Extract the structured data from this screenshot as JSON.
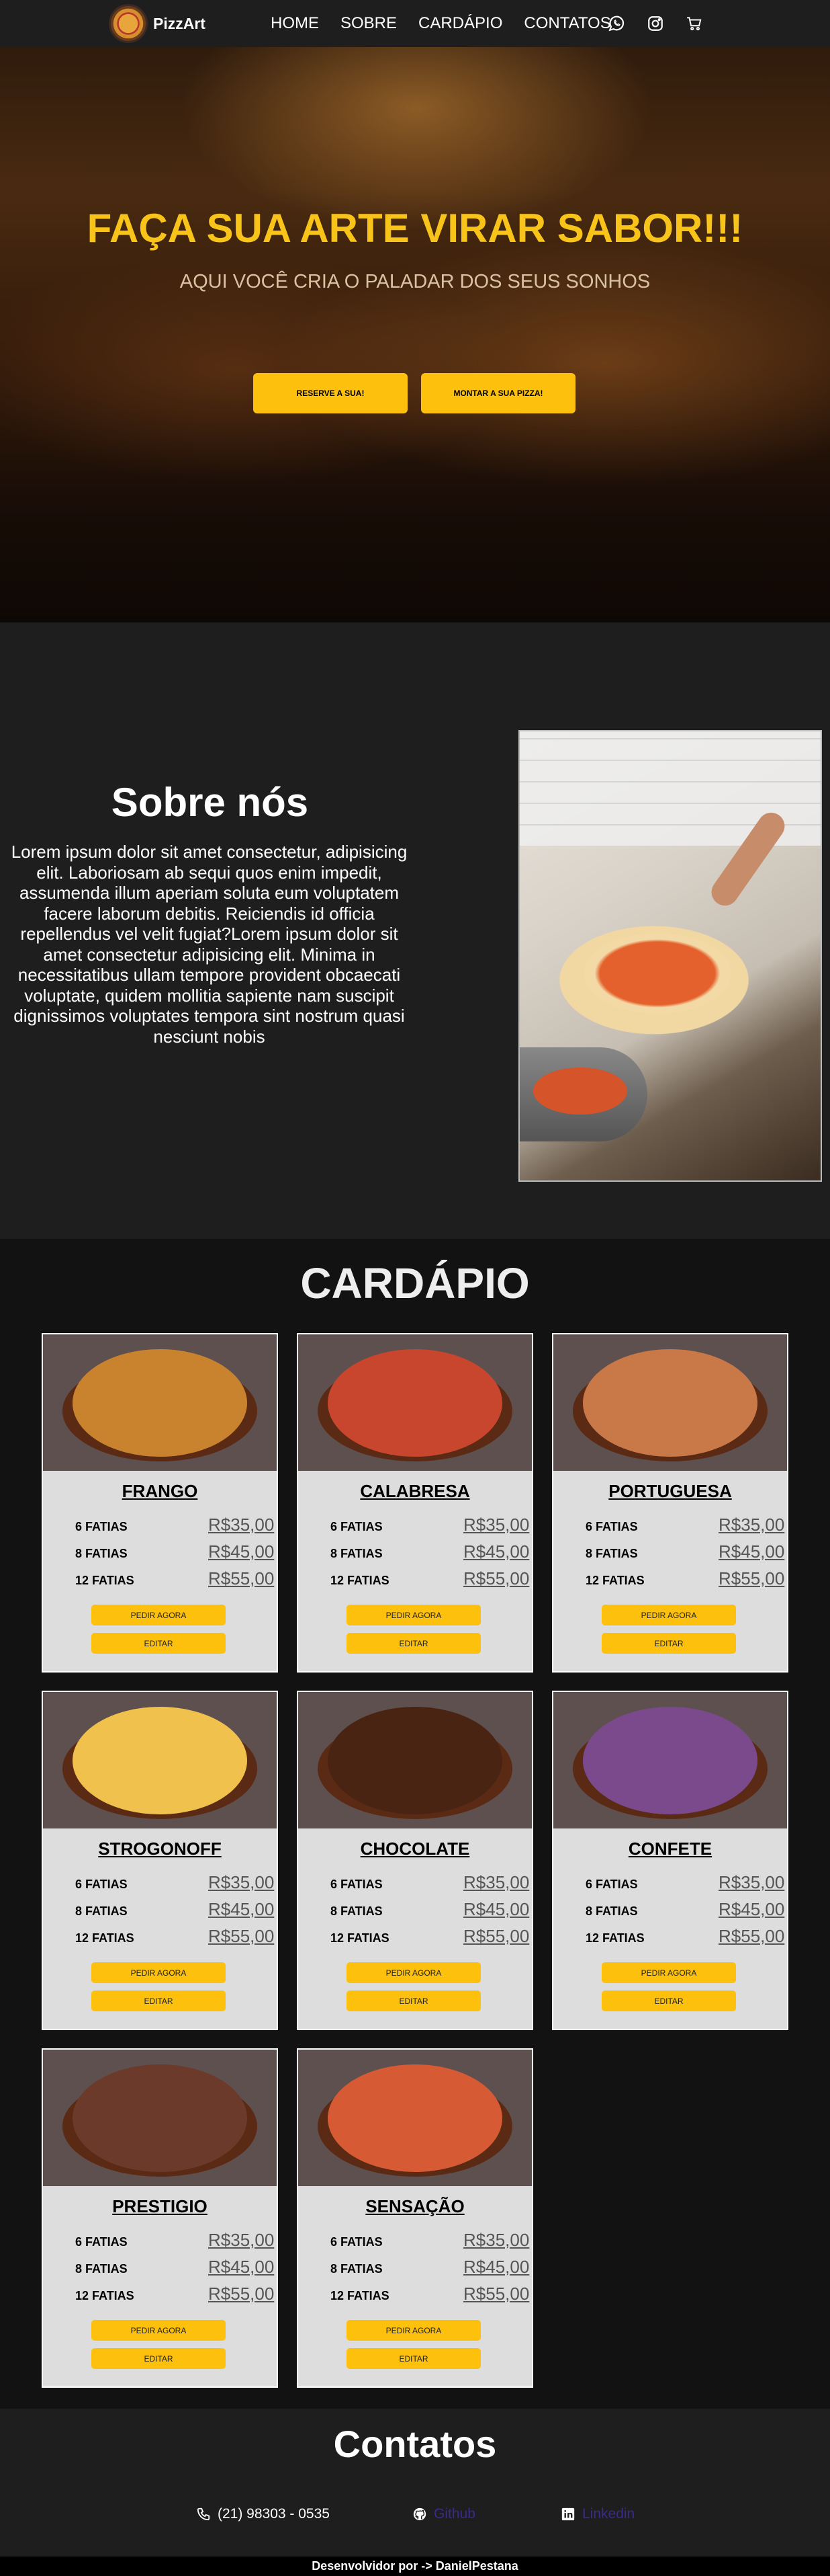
{
  "navbar": {
    "brand": "PizzArt",
    "links": [
      "HOME",
      "SOBRE",
      "CARDÁPIO",
      "CONTATOS"
    ],
    "icons": [
      "whatsapp-icon",
      "instagram-icon",
      "cart-icon"
    ]
  },
  "hero": {
    "title": "FAÇA SUA ARTE VIRAR SABOR!!!",
    "subtitle": "AQUI VOCÊ CRIA O PALADAR DOS SEUS SONHOS",
    "button_reserve": "RESERVE A SUA!",
    "button_build": "MONTAR A SUA PIZZA!"
  },
  "about": {
    "title": "Sobre nós",
    "text": "Lorem ipsum dolor sit amet consectetur, adipisicing elit. Laboriosam ab sequi quos enim impedit, assumenda illum aperiam soluta eum voluptatem facere laborum debitis. Reiciendis id officia repellendus vel velit fugiat?Lorem ipsum dolor sit amet consectetur adipisicing elit. Minima in necessitatibus ullam tempore provident obcaecati voluptate, quidem mollitia sapiente nam suscipit dignissimos voluptates tempora sint nostrum quasi nesciunt nobis"
  },
  "menu": {
    "title": "CARDÁPIO",
    "order_label": "PEDIR AGORA",
    "edit_label": "EDITAR",
    "sizes": [
      "6 FATIAS",
      "8 FATIAS",
      "12 FATIAS"
    ],
    "prices": [
      "R$35,00",
      "R$45,00",
      "R$55,00"
    ],
    "items": [
      {
        "name": "FRANGO",
        "topping": "#c9832f",
        "crust": "#8a5524"
      },
      {
        "name": "CALABRESA",
        "topping": "#c8452e",
        "crust": "#e9c98a"
      },
      {
        "name": "PORTUGUESA",
        "topping": "#c97848",
        "crust": "#d9a860"
      },
      {
        "name": "STROGONOFF",
        "topping": "#f0c14c",
        "crust": "#d79a3c"
      },
      {
        "name": "CHOCOLATE",
        "topping": "#4a2412",
        "crust": "#c58a50"
      },
      {
        "name": "CONFETE",
        "topping": "#7a4a8c",
        "crust": "#cfa066"
      },
      {
        "name": "PRESTIGIO",
        "topping": "#6b3a2a",
        "crust": "#e6d6cc"
      },
      {
        "name": "SENSAÇÃO",
        "topping": "#d65a33",
        "crust": "#e7a24b"
      }
    ]
  },
  "contacts": {
    "title": "Contatos",
    "phone": "(21) 98303 - 0535",
    "github": "Github",
    "linkedin": "Linkedin"
  },
  "footer": {
    "text": "Desenvolvidor por -> DanielPestana"
  }
}
